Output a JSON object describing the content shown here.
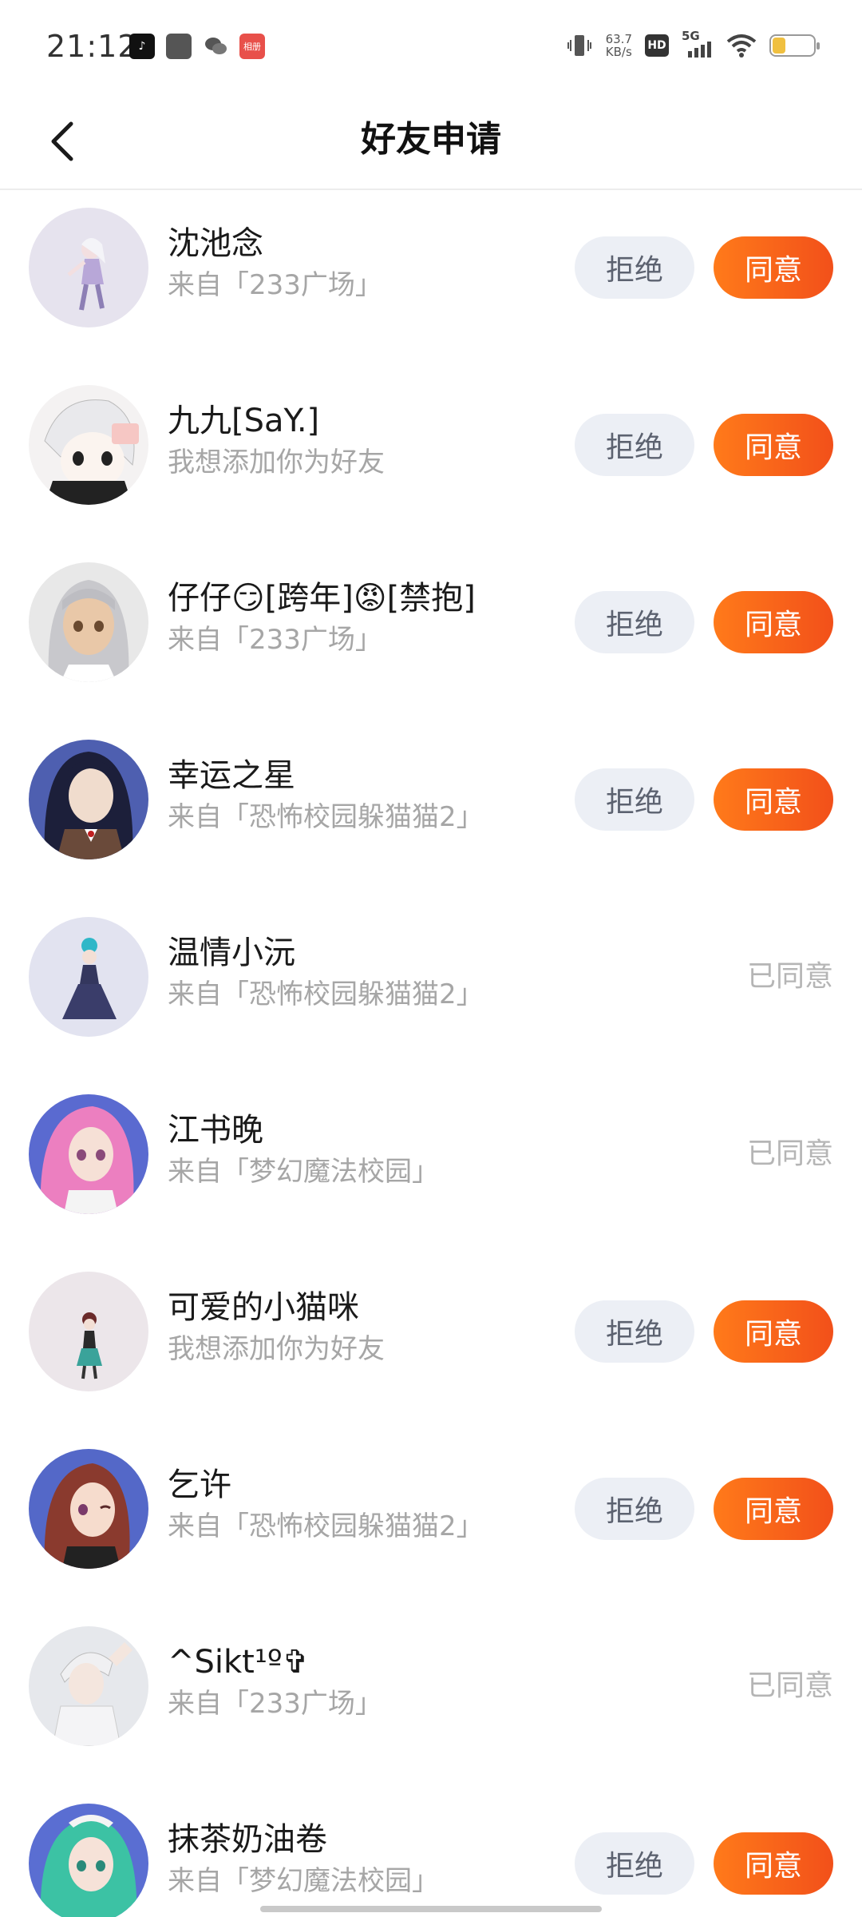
{
  "status_bar": {
    "time": "21:12",
    "net_speed_value": "63.7",
    "net_speed_unit": "KB/s",
    "hd_label": "HD",
    "network_label": "5G",
    "app_badge_label": "相册"
  },
  "header": {
    "title": "好友申请"
  },
  "buttons": {
    "reject_label": "拒绝",
    "accept_label": "同意",
    "accepted_label": "已同意"
  },
  "requests": [
    {
      "name": "沈池念",
      "source": "来自「233广场」",
      "status": "pending",
      "avatar": "girl-white-hair-icon"
    },
    {
      "name": "九九[SaY.]",
      "source": "我想添加你为好友",
      "status": "pending",
      "avatar": "chibi-white-hair-icon"
    },
    {
      "name": "仔仔😏[跨年]😡[禁抱]",
      "source": "来自「233广场」",
      "status": "pending",
      "avatar": "girl-silver-hair-icon"
    },
    {
      "name": "幸运之星",
      "source": "来自「恐怖校园躲猫猫2」",
      "status": "pending",
      "avatar": "girl-dark-hair-icon"
    },
    {
      "name": "温情小沅",
      "source": "来自「恐怖校园躲猫猫2」",
      "status": "accepted",
      "avatar": "girl-blue-dress-icon"
    },
    {
      "name": "江书晚",
      "source": "来自「梦幻魔法校园」",
      "status": "accepted",
      "avatar": "girl-pink-hair-icon"
    },
    {
      "name": "可爱的小猫咪",
      "source": "我想添加你为好友",
      "status": "pending",
      "avatar": "girl-small-figure-icon"
    },
    {
      "name": "乞许",
      "source": "来自「恐怖校园躲猫猫2」",
      "status": "pending",
      "avatar": "girl-auburn-hair-icon"
    },
    {
      "name": "^Sikt¹º✞",
      "source": "来自「233广场」",
      "status": "accepted",
      "avatar": "boy-white-outfit-icon"
    },
    {
      "name": "抹茶奶油卷",
      "source": "来自「梦幻魔法校园」",
      "status": "pending",
      "avatar": "girl-green-hair-icon"
    }
  ]
}
